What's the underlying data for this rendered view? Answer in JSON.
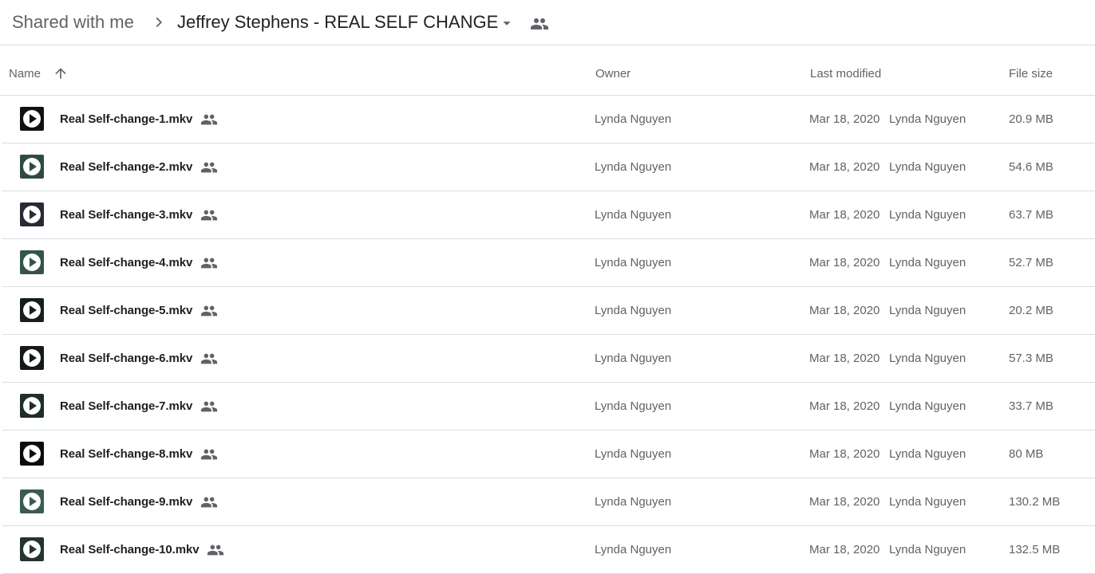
{
  "breadcrumb": {
    "root": "Shared with me",
    "separator_icon": "chevron-right-icon",
    "current": "Jeffrey Stephens - REAL SELF CHANGE",
    "dropdown_icon": "arrow-drop-down-icon",
    "shared_icon": "people-icon"
  },
  "columns": {
    "name": "Name",
    "sort_icon": "arrow-up-icon",
    "owner": "Owner",
    "last_modified": "Last modified",
    "file_size": "File size"
  },
  "files": [
    {
      "name": "Real Self-change-1.mkv",
      "owner": "Lynda Nguyen",
      "modified_date": "Mar 18, 2020",
      "modified_by": "Lynda Nguyen",
      "size": "20.9 MB",
      "thumb_color": "#111111"
    },
    {
      "name": "Real Self-change-2.mkv",
      "owner": "Lynda Nguyen",
      "modified_date": "Mar 18, 2020",
      "modified_by": "Lynda Nguyen",
      "size": "54.6 MB",
      "thumb_color": "#2f4a44"
    },
    {
      "name": "Real Self-change-3.mkv",
      "owner": "Lynda Nguyen",
      "modified_date": "Mar 18, 2020",
      "modified_by": "Lynda Nguyen",
      "size": "63.7 MB",
      "thumb_color": "#2a2a36"
    },
    {
      "name": "Real Self-change-4.mkv",
      "owner": "Lynda Nguyen",
      "modified_date": "Mar 18, 2020",
      "modified_by": "Lynda Nguyen",
      "size": "52.7 MB",
      "thumb_color": "#34544c"
    },
    {
      "name": "Real Self-change-5.mkv",
      "owner": "Lynda Nguyen",
      "modified_date": "Mar 18, 2020",
      "modified_by": "Lynda Nguyen",
      "size": "20.2 MB",
      "thumb_color": "#15201d"
    },
    {
      "name": "Real Self-change-6.mkv",
      "owner": "Lynda Nguyen",
      "modified_date": "Mar 18, 2020",
      "modified_by": "Lynda Nguyen",
      "size": "57.3 MB",
      "thumb_color": "#131a18"
    },
    {
      "name": "Real Self-change-7.mkv",
      "owner": "Lynda Nguyen",
      "modified_date": "Mar 18, 2020",
      "modified_by": "Lynda Nguyen",
      "size": "33.7 MB",
      "thumb_color": "#1e2e2a"
    },
    {
      "name": "Real Self-change-8.mkv",
      "owner": "Lynda Nguyen",
      "modified_date": "Mar 18, 2020",
      "modified_by": "Lynda Nguyen",
      "size": "80 MB",
      "thumb_color": "#0c0c0c"
    },
    {
      "name": "Real Self-change-9.mkv",
      "owner": "Lynda Nguyen",
      "modified_date": "Mar 18, 2020",
      "modified_by": "Lynda Nguyen",
      "size": "130.2 MB",
      "thumb_color": "#3a5c52"
    },
    {
      "name": "Real Self-change-10.mkv",
      "owner": "Lynda Nguyen",
      "modified_date": "Mar 18, 2020",
      "modified_by": "Lynda Nguyen",
      "size": "132.5 MB",
      "thumb_color": "#24342f"
    }
  ],
  "row_shared_icon": "people-icon",
  "file_type_icon": "video-play-icon"
}
